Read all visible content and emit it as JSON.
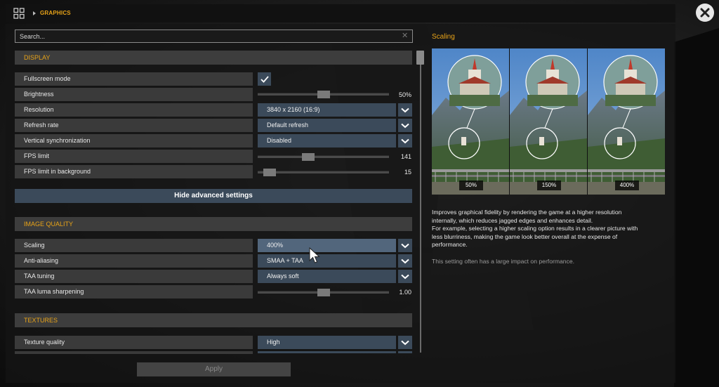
{
  "header": {
    "breadcrumb": "GRAPHICS"
  },
  "search": {
    "placeholder": "Search...",
    "clear_icon": "close-icon"
  },
  "sections": {
    "display": {
      "title": "DISPLAY",
      "fullscreen": {
        "label": "Fullscreen mode",
        "checked": true
      },
      "brightness": {
        "label": "Brightness",
        "value": "50%",
        "fraction": 0.5
      },
      "resolution": {
        "label": "Resolution",
        "value": "3840 x 2160 (16:9)"
      },
      "refresh": {
        "label": "Refresh rate",
        "value": "Default refresh"
      },
      "vsync": {
        "label": "Vertical synchronization",
        "value": "Disabled"
      },
      "fps_limit": {
        "label": "FPS limit",
        "value": "141",
        "fraction": 0.37
      },
      "fps_bg": {
        "label": "FPS limit in background",
        "value": "15",
        "fraction": 0.05
      }
    },
    "advanced_button": "Hide advanced settings",
    "image_quality": {
      "title": "IMAGE QUALITY",
      "scaling": {
        "label": "Scaling",
        "value": "400%"
      },
      "aa": {
        "label": "Anti-aliasing",
        "value": "SMAA + TAA"
      },
      "taa_tuning": {
        "label": "TAA tuning",
        "value": "Always soft"
      },
      "taa_sharpen": {
        "label": "TAA luma sharpening",
        "value": "1.00",
        "fraction": 0.5
      }
    },
    "textures": {
      "title": "TEXTURES",
      "texture_quality": {
        "label": "Texture quality",
        "value": "High"
      }
    }
  },
  "apply_label": "Apply",
  "info": {
    "title": "Scaling",
    "preview_labels": [
      "50%",
      "150%",
      "400%"
    ],
    "desc_lines": [
      "Improves graphical fidelity by rendering the game at a higher resolution",
      "internally, which reduces jagged edges and enhances detail.",
      "For example, selecting a higher scaling option results in a clearer picture with",
      "less blurriness, making the game look better overall at the expense of",
      "performance."
    ],
    "perf_note": "This setting often has a large impact on performance."
  },
  "colors": {
    "accent": "#e8a318",
    "control": "#3b4a5a",
    "control_hover": "#52667c"
  }
}
